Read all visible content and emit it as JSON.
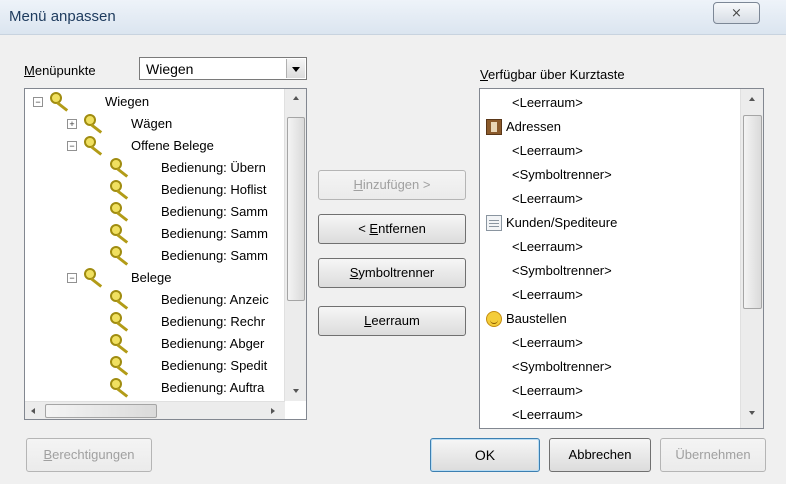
{
  "window": {
    "title": "Menü anpassen",
    "close_glyph": "⨯"
  },
  "menu_items": {
    "label_prefix": "",
    "label_mnemonic": "M",
    "label_rest": "enüpunkte",
    "selected": "Wiegen"
  },
  "tree": {
    "items": [
      {
        "label": "Wiegen",
        "level": 0,
        "expander": "−"
      },
      {
        "label": "Wägen",
        "level": 1,
        "expander": "+"
      },
      {
        "label": "Offene Belege",
        "level": 1,
        "expander": "−"
      },
      {
        "label": "Bedienung: Übern",
        "level": 2,
        "expander": ""
      },
      {
        "label": "Bedienung: Hoflist",
        "level": 2,
        "expander": ""
      },
      {
        "label": "Bedienung: Samm",
        "level": 2,
        "expander": ""
      },
      {
        "label": "Bedienung: Samm",
        "level": 2,
        "expander": ""
      },
      {
        "label": "Bedienung: Samm",
        "level": 2,
        "expander": ""
      },
      {
        "label": "Belege",
        "level": 1,
        "expander": "−"
      },
      {
        "label": "Bedienung: Anzeic",
        "level": 2,
        "expander": ""
      },
      {
        "label": "Bedienung: Rechr",
        "level": 2,
        "expander": ""
      },
      {
        "label": "Bedienung: Abger",
        "level": 2,
        "expander": ""
      },
      {
        "label": "Bedienung: Spedit",
        "level": 2,
        "expander": ""
      },
      {
        "label": "Bedienung: Auftra",
        "level": 2,
        "expander": ""
      }
    ]
  },
  "buttons": {
    "add": {
      "mnemonic": "H",
      "rest": "inzufügen >"
    },
    "remove": {
      "prefix": "< ",
      "mnemonic": "E",
      "rest": "ntfernen"
    },
    "separator": {
      "mnemonic": "S",
      "rest": "ymboltrenner"
    },
    "space": {
      "mnemonic": "L",
      "rest": "eerraum"
    },
    "permissions": {
      "mnemonic": "B",
      "rest": "erechtigungen"
    },
    "ok": "OK",
    "cancel": "Abbrechen",
    "apply": "Übernehmen"
  },
  "available": {
    "label_mnemonic": "V",
    "label_rest": "erfügbar über Kurztaste",
    "items": [
      {
        "label": "<Leerraum>",
        "icon": ""
      },
      {
        "label": "Adressen",
        "icon": "book-icon"
      },
      {
        "label": "<Leerraum>",
        "icon": ""
      },
      {
        "label": "<Symboltrenner>",
        "icon": ""
      },
      {
        "label": "<Leerraum>",
        "icon": ""
      },
      {
        "label": "Kunden/Spediteure",
        "icon": "table-icon"
      },
      {
        "label": "<Leerraum>",
        "icon": ""
      },
      {
        "label": "<Symboltrenner>",
        "icon": ""
      },
      {
        "label": "<Leerraum>",
        "icon": ""
      },
      {
        "label": "Baustellen",
        "icon": "smiley-icon"
      },
      {
        "label": "<Leerraum>",
        "icon": ""
      },
      {
        "label": "<Symboltrenner>",
        "icon": ""
      },
      {
        "label": "<Leerraum>",
        "icon": ""
      },
      {
        "label": "<Leerraum>",
        "icon": ""
      }
    ]
  },
  "colors": {
    "title_text": "#1e3b5e",
    "dialog_bg": "#f0f0f0",
    "disabled_text": "#a0a0a0"
  }
}
